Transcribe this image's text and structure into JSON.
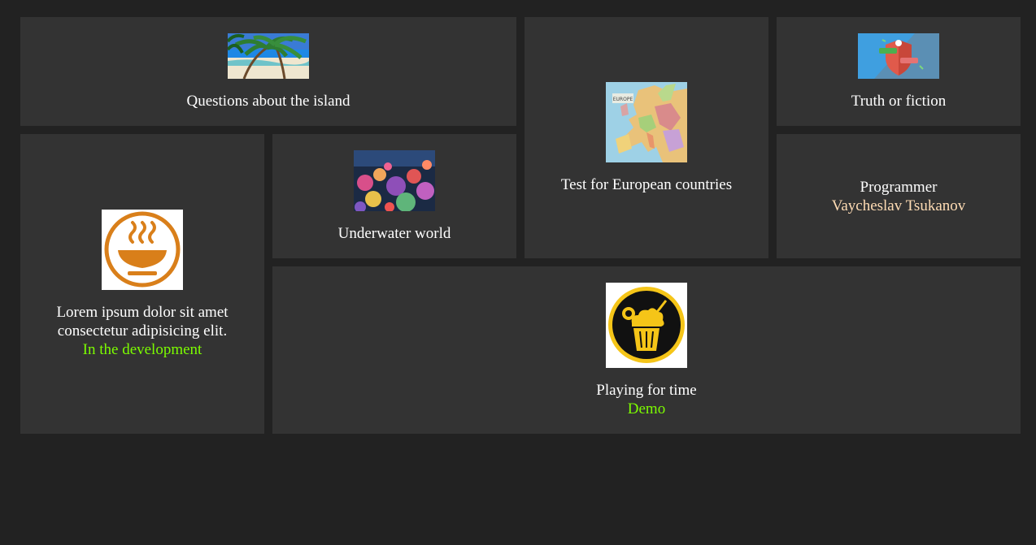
{
  "tiles": {
    "island": {
      "title": "Questions about the island",
      "image": "palm-beach-image"
    },
    "europe": {
      "title": "Test for European countries",
      "image": "europe-map-image"
    },
    "truth": {
      "title": "Truth or fiction",
      "image": "shield-image"
    },
    "lorem": {
      "line1": "Lorem ipsum dolor sit amet",
      "line2": "consectetur adipisicing elit.",
      "status": "In the development",
      "image": "soup-bowl-icon"
    },
    "underwater": {
      "title": "Underwater world",
      "image": "coral-reef-image"
    },
    "programmer": {
      "label": "Programmer",
      "name": "Vaycheslav Tsukanov"
    },
    "playing": {
      "title": "Playing for time",
      "status": "Demo",
      "image": "drink-cup-icon"
    }
  },
  "colors": {
    "page_bg": "#222222",
    "tile_bg": "#333333",
    "status_green": "#7cfc00",
    "author_peach": "#ffdcb4"
  }
}
